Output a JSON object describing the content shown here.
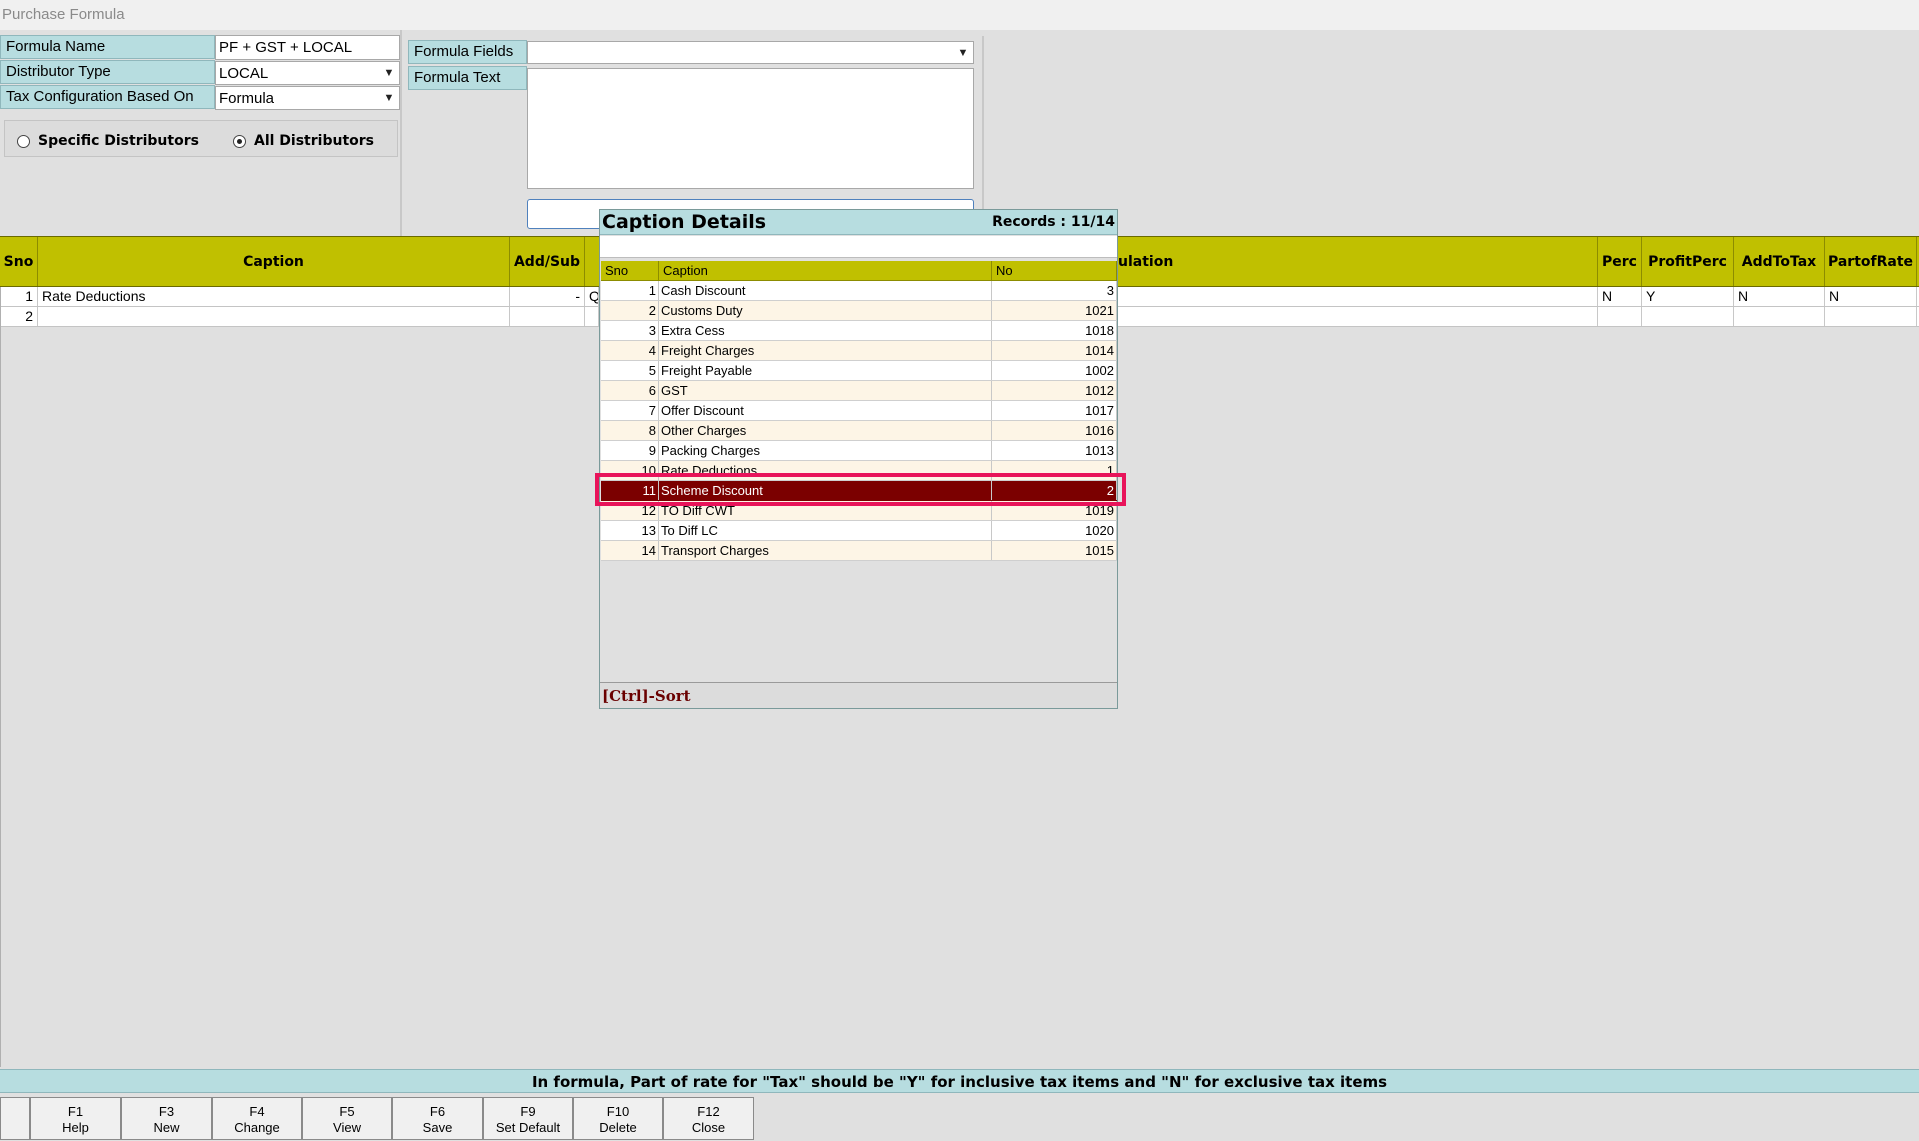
{
  "window": {
    "title": "Purchase Formula"
  },
  "form": {
    "formula_name_label": "Formula Name",
    "formula_name_value": "PF + GST + LOCAL",
    "distributor_type_label": "Distributor Type",
    "distributor_type_value": "LOCAL",
    "tax_config_label": "Tax Configuration Based On",
    "tax_config_value": "Formula",
    "formula_fields_label": "Formula Fields",
    "formula_fields_value": "",
    "formula_text_label": "Formula Text",
    "formula_text_value": ""
  },
  "distributors": {
    "specific_label": "Specific Distributors",
    "all_label": "All Distributors",
    "selected": "all"
  },
  "grid": {
    "headers": {
      "sno": "Sno",
      "caption": "Caption",
      "add_sub": "Add/Sub",
      "calculation": "ulation",
      "perc": "Perc",
      "profit_perc": "ProfitPerc",
      "add_to_tax": "AddToTax",
      "part_of_rate": "PartofRate"
    },
    "rows": [
      {
        "sno": "1",
        "caption": "Rate Deductions",
        "add_sub": "-",
        "calc": "Q",
        "perc": "N",
        "profit_perc": "Y",
        "add_to_tax": "N",
        "part_of_rate": "N"
      },
      {
        "sno": "2",
        "caption": "",
        "add_sub": "",
        "calc": "",
        "perc": "",
        "profit_perc": "",
        "add_to_tax": "",
        "part_of_rate": ""
      }
    ]
  },
  "popup": {
    "title": "Caption Details",
    "records": "Records : 11/14",
    "search_value": "",
    "headers": {
      "sno": "Sno",
      "caption": "Caption",
      "no": "No"
    },
    "rows": [
      {
        "sno": "1",
        "caption": "Cash Discount",
        "no": "3"
      },
      {
        "sno": "2",
        "caption": "Customs Duty",
        "no": "1021"
      },
      {
        "sno": "3",
        "caption": "Extra Cess",
        "no": "1018"
      },
      {
        "sno": "4",
        "caption": "Freight Charges",
        "no": "1014"
      },
      {
        "sno": "5",
        "caption": "Freight Payable",
        "no": "1002"
      },
      {
        "sno": "6",
        "caption": "GST",
        "no": "1012"
      },
      {
        "sno": "7",
        "caption": "Offer Discount",
        "no": "1017"
      },
      {
        "sno": "8",
        "caption": "Other Charges",
        "no": "1016"
      },
      {
        "sno": "9",
        "caption": "Packing Charges",
        "no": "1013"
      },
      {
        "sno": "10",
        "caption": "Rate Deductions",
        "no": "1"
      },
      {
        "sno": "11",
        "caption": "Scheme Discount",
        "no": "2"
      },
      {
        "sno": "12",
        "caption": "TO Diff CWT",
        "no": "1019"
      },
      {
        "sno": "13",
        "caption": "To Diff LC",
        "no": "1020"
      },
      {
        "sno": "14",
        "caption": "Transport Charges",
        "no": "1015"
      }
    ],
    "selected_sno": "11",
    "footer": "[Ctrl]-Sort"
  },
  "note": "In formula, Part of rate for \"Tax\" should be \"Y\" for inclusive tax items and \"N\" for exclusive tax items",
  "function_keys": [
    {
      "key": "F1",
      "label": "Help"
    },
    {
      "key": "F3",
      "label": "New"
    },
    {
      "key": "F4",
      "label": "Change"
    },
    {
      "key": "F5",
      "label": "View"
    },
    {
      "key": "F6",
      "label": "Save"
    },
    {
      "key": "F9",
      "label": "Set Default"
    },
    {
      "key": "F10",
      "label": "Delete"
    },
    {
      "key": "F12",
      "label": "Close"
    }
  ],
  "colors": {
    "label_bg": "#b7dde0",
    "grid_header_bg": "#c0c000",
    "selected_row_bg": "#7b0000",
    "highlight_border": "#e8145a"
  }
}
